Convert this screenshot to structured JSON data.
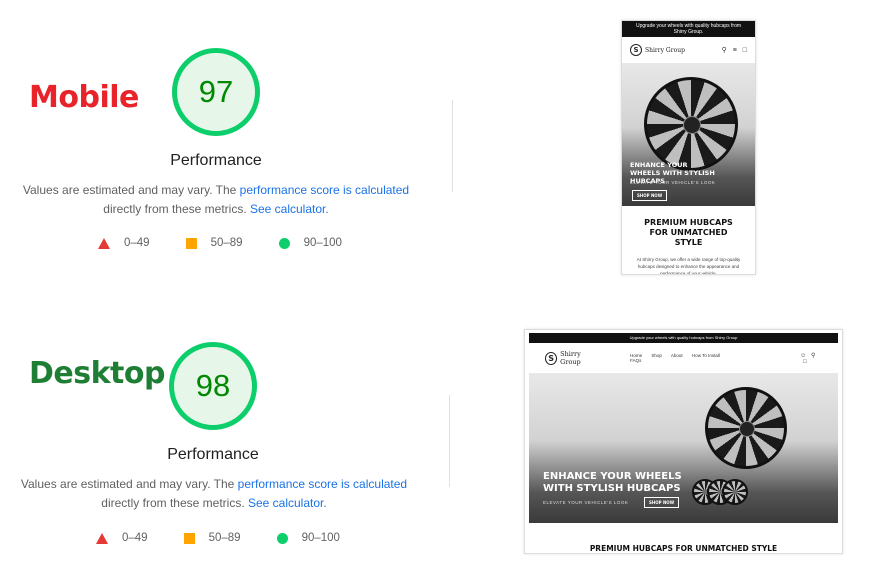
{
  "mobile": {
    "label": "Mobile",
    "score": "97",
    "performance_title": "Performance",
    "desc_text": "Values are estimated and may vary. The ",
    "desc_link1": "performance score is calculated",
    "desc_text2": "directly from these metrics. ",
    "desc_link2": "See calculator.",
    "legend": [
      "0–49",
      "50–89",
      "90–100"
    ]
  },
  "desktop": {
    "label": "Desktop",
    "score": "98",
    "performance_title": "Performance",
    "desc_text": "Values are estimated and may vary. The ",
    "desc_link1": "performance score is calculated",
    "desc_text2": "directly from these metrics. ",
    "desc_link2": "See calculator.",
    "legend": [
      "0–49",
      "50–89",
      "90–100"
    ]
  },
  "colors": {
    "mobile_label": "#e8232a",
    "desktop_label": "#1e7e34",
    "gauge_ring": "#0cce6b",
    "gauge_fill": "#e6f7ea",
    "score_text": "#008800",
    "link": "#1a73e8",
    "fail": "#e53935",
    "average": "#ffa400",
    "pass": "#0cce6b"
  },
  "mobile_preview": {
    "announcement": "Upgrade your wheels with quality hubcaps from Shirry Group.",
    "logo_text": "Shirry Group",
    "hero_heading": "ENHANCE YOUR WHEELS WITH STYLISH HUBCAPS",
    "hero_sub": "ELEVATE YOUR VEHICLE'S LOOK",
    "shop_button": "SHOP NOW",
    "section_heading": "PREMIUM HUBCAPS FOR UNMATCHED STYLE",
    "section_body": "At Shirry Group, we offer a wide range of top-quality hubcaps designed to enhance the appearance and performance of your vehicle."
  },
  "desktop_preview": {
    "announcement": "Upgrade your wheels with quality hubcaps from Shirry Group",
    "logo_text": "Shirry Group",
    "nav": [
      "Home",
      "Shop",
      "About",
      "How To Install",
      "FAQs"
    ],
    "hero_heading_1": "ENHANCE YOUR WHEELS",
    "hero_heading_2": "WITH STYLISH HUBCAPS",
    "hero_sub": "ELEVATE YOUR VEHICLE'S LOOK",
    "shop_button": "SHOP NOW",
    "section_heading": "PREMIUM HUBCAPS FOR UNMATCHED STYLE"
  }
}
